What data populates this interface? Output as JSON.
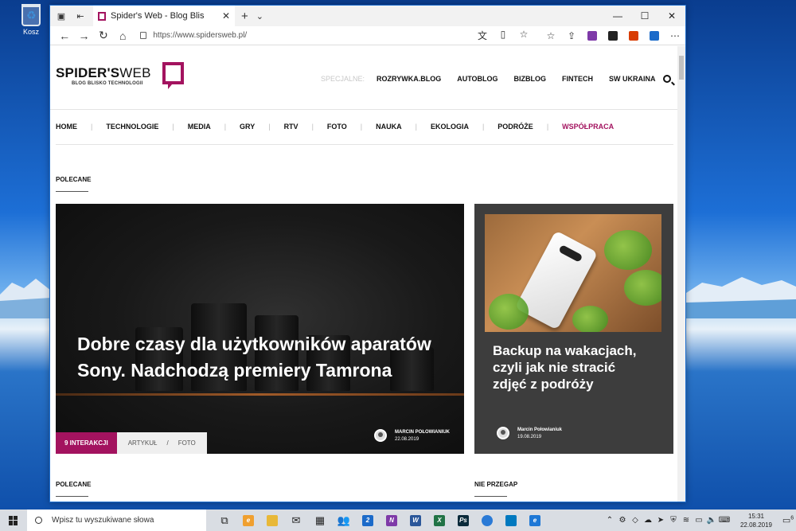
{
  "desktop": {
    "recycle_bin_label": "Kosz"
  },
  "browser": {
    "tab_title": "Spider's Web - Blog Blis",
    "url": "https://www.spidersweb.pl/",
    "window_controls": {
      "minimize": "—",
      "maximize": "☐",
      "close": "✕"
    }
  },
  "site": {
    "logo_main": "SPIDER'S",
    "logo_web": "WEB",
    "logo_tagline": "BLOG BLISKO TECHNOLOGII",
    "special_label": "SPECJALNE:",
    "special_links": [
      "ROZRYWKA.BLOG",
      "AUTOBLOG",
      "BIZBLOG",
      "FINTECH",
      "SW UKRAINA"
    ],
    "main_nav": [
      "HOME",
      "TECHNOLOGIE",
      "MEDIA",
      "GRY",
      "RTV",
      "FOTO",
      "NAUKA",
      "EKOLOGIA",
      "PODRÓŻE",
      "WSPÓŁPRACA"
    ],
    "section_top": "POLECANE",
    "section_bottom_left": "POLECANE",
    "section_bottom_right": "NIE PRZEGAP",
    "hero": {
      "title": "Dobre czasy dla użytkowników aparatów Sony. Nadchodzą premiery Tamrona",
      "interactions": "9 INTERAKCJI",
      "category_1": "ARTYKUŁ",
      "category_sep": "/",
      "category_2": "FOTO",
      "author": "MARCIN POŁOWIANIUK",
      "date": "22.08.2019"
    },
    "side": {
      "title": "Backup na wakacjach, czyli jak nie stracić zdjęć z podróży",
      "author": "Marcin Połowianiuk",
      "date": "19.08.2019"
    },
    "accent_color": "#a3135f"
  },
  "taskbar": {
    "search_placeholder": "Wpisz tu wyszukiwane słowa",
    "time": "15:31",
    "date": "22.08.2019",
    "notification_count": "6",
    "mail_badge": "2"
  }
}
